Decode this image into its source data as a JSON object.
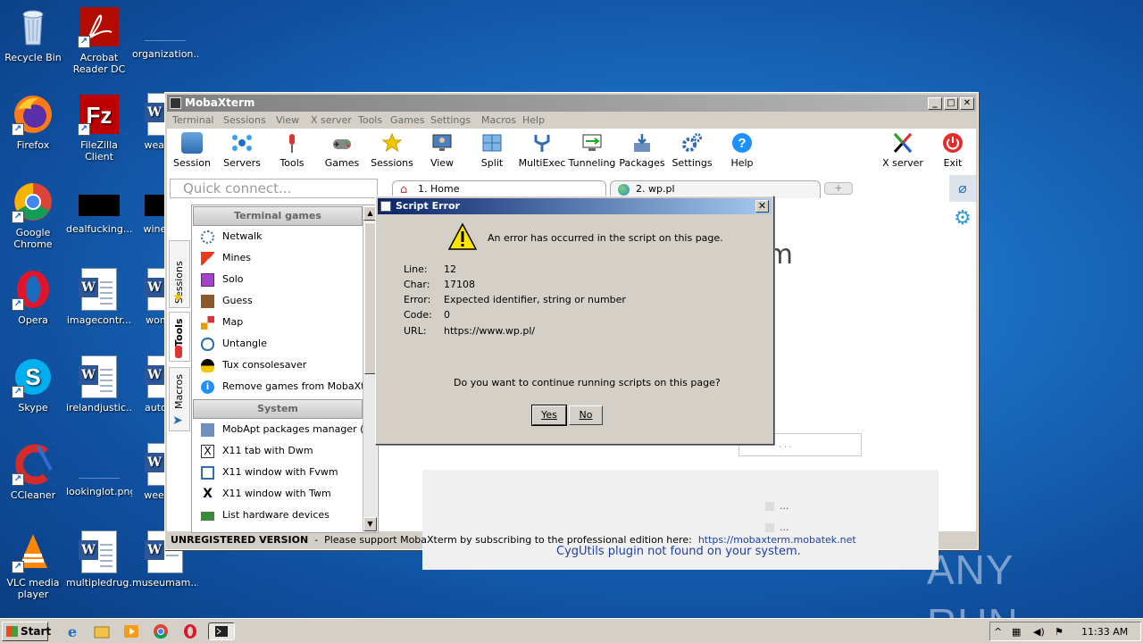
{
  "desktop": {
    "icons": [
      {
        "label": "Recycle Bin"
      },
      {
        "label": "Acrobat Reader DC"
      },
      {
        "label": "organization..."
      },
      {
        "label": "Firefox"
      },
      {
        "label": "FileZilla Client"
      },
      {
        "label": "weann..."
      },
      {
        "label": "Google Chrome"
      },
      {
        "label": "dealfucking..."
      },
      {
        "label": "winexe..."
      },
      {
        "label": "Opera"
      },
      {
        "label": "imagecontr..."
      },
      {
        "label": "woma..."
      },
      {
        "label": "Skype"
      },
      {
        "label": "irelandjustic..."
      },
      {
        "label": "autom..."
      },
      {
        "label": "CCleaner"
      },
      {
        "label": "lookinglot.png"
      },
      {
        "label": "weekly..."
      },
      {
        "label": "VLC media player"
      },
      {
        "label": "multipledrug..."
      },
      {
        "label": "museumam..."
      }
    ],
    "watermark": "ANY RUN"
  },
  "mobaxterm": {
    "title": "MobaXterm",
    "menu": [
      "Terminal",
      "Sessions",
      "View",
      "X server",
      "Tools",
      "Games",
      "Settings",
      "Macros",
      "Help"
    ],
    "toolbar": [
      {
        "label": "Session",
        "icon": "session-icon"
      },
      {
        "label": "Servers",
        "icon": "servers-icon"
      },
      {
        "label": "Tools",
        "icon": "tools-icon"
      },
      {
        "label": "Games",
        "icon": "games-icon"
      },
      {
        "label": "Sessions",
        "icon": "star-icon"
      },
      {
        "label": "View",
        "icon": "view-icon"
      },
      {
        "label": "Split",
        "icon": "split-icon"
      },
      {
        "label": "MultiExec",
        "icon": "multiexec-icon"
      },
      {
        "label": "Tunneling",
        "icon": "tunneling-icon"
      },
      {
        "label": "Packages",
        "icon": "packages-icon"
      },
      {
        "label": "Settings",
        "icon": "settings-icon"
      },
      {
        "label": "Help",
        "icon": "help-icon"
      },
      {
        "label": "X server",
        "icon": "xserver-icon"
      },
      {
        "label": "Exit",
        "icon": "exit-icon"
      }
    ],
    "quick_connect_placeholder": "Quick connect...",
    "vertical_tabs": [
      "Sessions",
      "Tools",
      "Macros"
    ],
    "groups": {
      "terminal_games": "Terminal games",
      "system": "System"
    },
    "games_items": [
      "Netwalk",
      "Mines",
      "Solo",
      "Guess",
      "Map",
      "Untangle",
      "Tux consolesaver",
      "Remove games from MobaXterm"
    ],
    "system_items": [
      "MobApt packages manager (expe",
      "X11 tab with Dwm",
      "X11 window with Fvwm",
      "X11 window with Twm",
      "List hardware devices"
    ],
    "tabs": [
      "1. Home",
      "2. wp.pl"
    ],
    "home": {
      "partial_heading": "rm",
      "search_partial": "...",
      "ellipsis_1": "...",
      "ellipsis_2": "...",
      "plugin_msg": "CygUtils plugin not found on your system."
    },
    "status": {
      "unregistered": "UNREGISTERED VERSION",
      "message": "  -  Please support MobaXterm by subscribing to the professional edition here:  ",
      "link": "https://mobaxterm.mobatek.net"
    }
  },
  "dialog": {
    "title": "Script Error",
    "message": "An error has occurred in the script on this page.",
    "fields": [
      {
        "label": "Line:",
        "value": "12"
      },
      {
        "label": "Char:",
        "value": "17108"
      },
      {
        "label": "Error:",
        "value": "Expected identifier, string or number"
      },
      {
        "label": "Code:",
        "value": "0"
      },
      {
        "label": "URL:",
        "value": "https://www.wp.pl/"
      }
    ],
    "question": "Do you want to continue running scripts on this page?",
    "yes": "Yes",
    "no": "No"
  },
  "taskbar": {
    "start": "Start",
    "clock": "11:33 AM"
  }
}
